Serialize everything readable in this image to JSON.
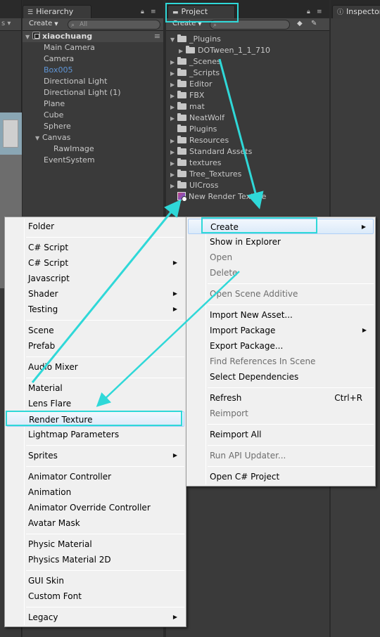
{
  "left_strip": {
    "toolbar_text": "s ▾"
  },
  "hierarchy": {
    "tab_label": "Hierarchy",
    "create_label": "Create",
    "search_placeholder": "All",
    "scene_name": "xiaochuang",
    "items": [
      {
        "label": "Main Camera"
      },
      {
        "label": "Camera"
      },
      {
        "label": "Box005"
      },
      {
        "label": "Directional Light"
      },
      {
        "label": "Directional Light (1)"
      },
      {
        "label": "Plane"
      },
      {
        "label": "Cube"
      },
      {
        "label": "Sphere"
      },
      {
        "label": "Canvas"
      },
      {
        "label": "RawImage"
      },
      {
        "label": "EventSystem"
      }
    ]
  },
  "project": {
    "tab_label": "Project",
    "create_label": "Create",
    "items": [
      {
        "label": "_Plugins"
      },
      {
        "label": "DOTween_1_1_710"
      },
      {
        "label": "_Scenes"
      },
      {
        "label": "_Scripts"
      },
      {
        "label": "Editor"
      },
      {
        "label": "FBX"
      },
      {
        "label": "mat"
      },
      {
        "label": "NeatWolf"
      },
      {
        "label": "Plugins"
      },
      {
        "label": "Resources"
      },
      {
        "label": "Standard Assets"
      },
      {
        "label": "textures"
      },
      {
        "label": "Tree_Textures"
      },
      {
        "label": "UICross"
      },
      {
        "label": "New Render Texture"
      }
    ]
  },
  "inspector": {
    "tab_label": "Inspector"
  },
  "create_submenu": {
    "items": [
      {
        "label": "Folder"
      },
      {
        "label": "C# Script"
      },
      {
        "label": "C# Script"
      },
      {
        "label": "Javascript"
      },
      {
        "label": "Shader"
      },
      {
        "label": "Testing"
      },
      {
        "label": "Scene"
      },
      {
        "label": "Prefab"
      },
      {
        "label": "Audio Mixer"
      },
      {
        "label": "Material"
      },
      {
        "label": "Lens Flare"
      },
      {
        "label": "Render Texture"
      },
      {
        "label": "Lightmap Parameters"
      },
      {
        "label": "Sprites"
      },
      {
        "label": "Animator Controller"
      },
      {
        "label": "Animation"
      },
      {
        "label": "Animator Override Controller"
      },
      {
        "label": "Avatar Mask"
      },
      {
        "label": "Physic Material"
      },
      {
        "label": "Physics Material 2D"
      },
      {
        "label": "GUI Skin"
      },
      {
        "label": "Custom Font"
      },
      {
        "label": "Legacy"
      }
    ]
  },
  "context_menu": {
    "items": [
      {
        "label": "Create"
      },
      {
        "label": "Show in Explorer"
      },
      {
        "label": "Open"
      },
      {
        "label": "Delete"
      },
      {
        "label": "Open Scene Additive"
      },
      {
        "label": "Import New Asset..."
      },
      {
        "label": "Import Package"
      },
      {
        "label": "Export Package..."
      },
      {
        "label": "Find References In Scene"
      },
      {
        "label": "Select Dependencies"
      },
      {
        "label": "Refresh",
        "shortcut": "Ctrl+R"
      },
      {
        "label": "Reimport"
      },
      {
        "label": "Reimport All"
      },
      {
        "label": "Run API Updater..."
      },
      {
        "label": "Open C# Project"
      }
    ]
  },
  "colors": {
    "annotation": "#2fd8d8",
    "selected_object": "#5f95d6"
  }
}
